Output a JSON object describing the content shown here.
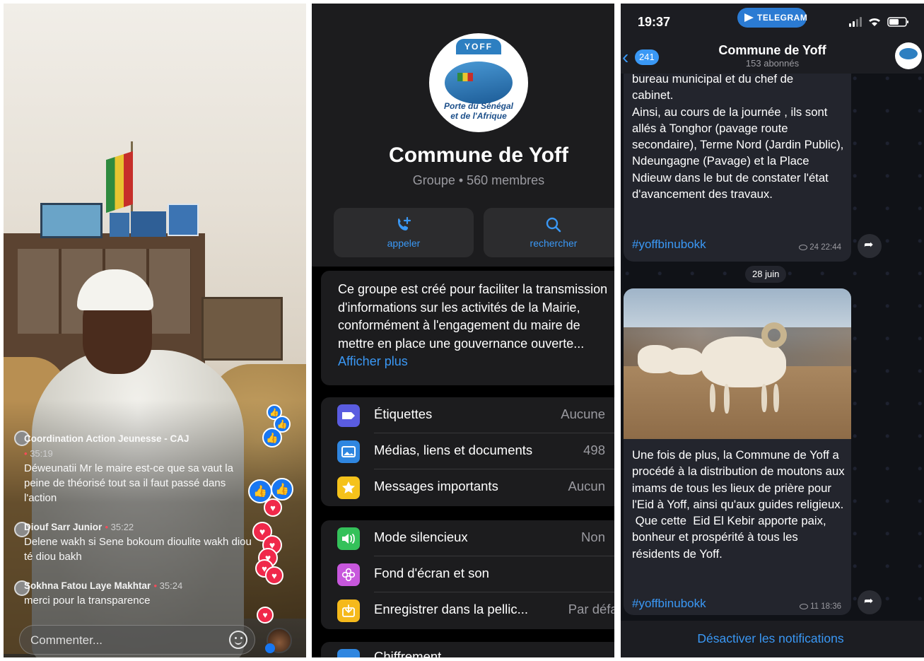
{
  "facebook_live": {
    "comments": [
      {
        "name": "Coordination Action Jeunesse - CAJ",
        "time": "35:19",
        "text": "Déweunatii Mr le maire est-ce que sa vaut la peine de théorisé tout sa il faut passé dans l'action"
      },
      {
        "name": "Diouf Sarr Junior",
        "time": "35:22",
        "text": "Delene wakh si Sene bokoum dioulite wakh diou té diou bakh"
      },
      {
        "name": "Sokhna Fatou Laye Makhtar",
        "time": "35:24",
        "text": "merci pour la transparence"
      }
    ],
    "comment_placeholder": "Commenter..."
  },
  "group_info": {
    "logo": {
      "top_text": "YOFF",
      "tagline_1": "Porte du Sénégal",
      "tagline_2": "et de l'Afrique"
    },
    "title": "Commune de Yoff",
    "subtitle": "Groupe • 560 membres",
    "actions": {
      "call": "appeler",
      "search": "rechercher"
    },
    "description": "Ce groupe est créé pour faciliter la transmission d'informations sur les activités de la Mairie, conformément à l'engagement du maire de mettre en place une gouvernance ouverte...",
    "show_more": "Afficher plus",
    "rows_1": [
      {
        "label": "Étiquettes",
        "value": "Aucune",
        "icon": "tag-icon"
      },
      {
        "label": "Médias, liens et documents",
        "value": "498",
        "icon": "media-icon"
      },
      {
        "label": "Messages importants",
        "value": "Aucun",
        "icon": "star-icon"
      }
    ],
    "rows_2": [
      {
        "label": "Mode silencieux",
        "value": "Non",
        "icon": "speaker-icon"
      },
      {
        "label": "Fond d'écran et son",
        "value": "",
        "icon": "flower-icon"
      },
      {
        "label": "Enregistrer dans la pellic...",
        "value": "Par défau",
        "icon": "download-icon"
      }
    ],
    "rows_3": [
      {
        "label": "Chiffrement",
        "icon": "lock-icon"
      }
    ]
  },
  "channel": {
    "status_time": "19:37",
    "app_pill": "TELEGRAM",
    "back_count": "241",
    "title": "Commune de Yoff",
    "subscribers": "153 abonnés",
    "post1": {
      "text": "bureau municipal et du chef de\ncabinet.\nAinsi, au cours de la journée , ils sont allés à Tonghor (pavage route secondaire), Terme Nord (Jardin Public), Ndeungagne (Pavage) et la Place Ndieuw dans le but de constater l'état d'avancement des travaux.",
      "hashtag": "#yoffbinubokk",
      "views": "24",
      "time": "22:44"
    },
    "date_separator": "28 juin",
    "post2": {
      "text": "Une fois de plus, la Commune de Yoff a procédé à la distribution de moutons aux imams de tous les lieux de prière pour l'Eid à Yoff, ainsi qu'aux guides religieux.\n Que cette  Eid El Kebir apporte paix, bonheur et prospérité à tous les résidents de Yoff.",
      "hashtag": "#yoffbinubokk",
      "views": "11",
      "time": "18:36"
    },
    "bottom_action": "Désactiver les notifications"
  },
  "colors": {
    "telegram_blue": "#3a98f5",
    "facebook_blue": "#1877f2",
    "love_red": "#f0284a"
  }
}
